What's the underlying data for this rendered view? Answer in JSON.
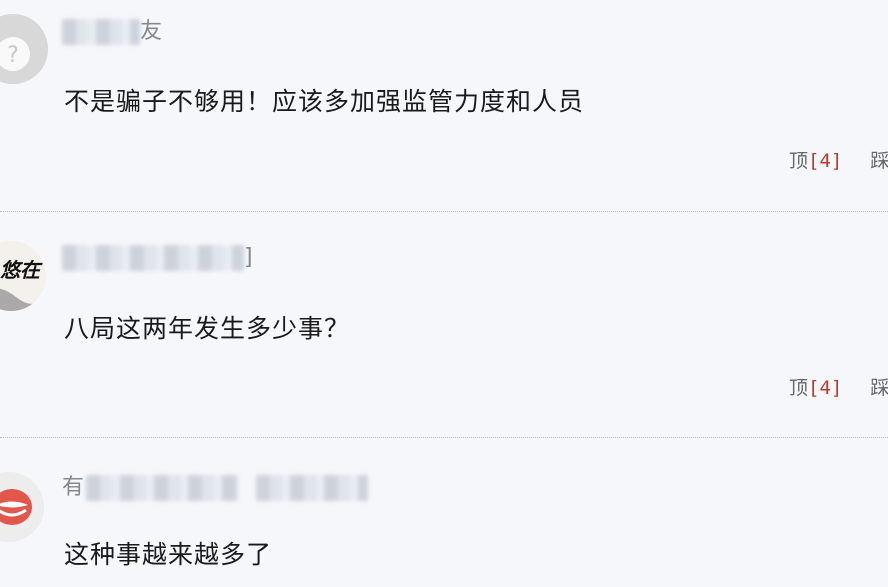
{
  "comments": [
    {
      "author_suffix": "友",
      "text": "不是骗子不够用！应该多加强监管力度和人员",
      "up_label": "顶",
      "up_count_display": "[4]",
      "down_label_partial": "踩"
    },
    {
      "author_suffix": "]",
      "text": "八局这两年发生多少事？",
      "up_label": "顶",
      "up_count_display": "[4]",
      "down_label_partial": "踩",
      "avatar_text": "悠在"
    },
    {
      "author_prefix": "有",
      "text": "这种事越来越多了"
    }
  ],
  "colors": {
    "background": "#f5f7fb",
    "vote_count": "#c0392b",
    "avatar3_accent": "#e2574c"
  }
}
